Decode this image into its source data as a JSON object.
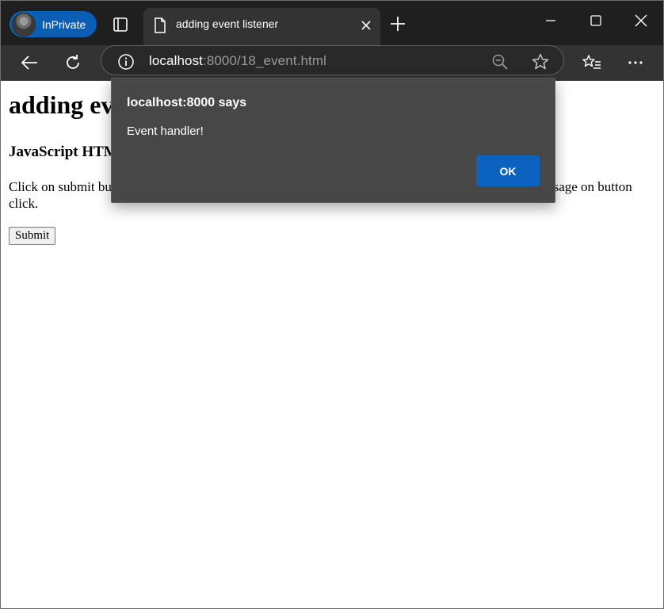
{
  "browser": {
    "inprivate_label": "InPrivate",
    "tab_title": "adding event listener",
    "address": {
      "host": "localhost",
      "path": ":8000/18_event.html"
    }
  },
  "page": {
    "heading": "adding event listener",
    "subheading": "JavaScript HTML DOM EventListener",
    "paragraph": "Click on submit button to see the addEventListener() method in action. This will display an alert message on button click.",
    "submit_label": "Submit"
  },
  "dialog": {
    "title": "localhost:8000 says",
    "message": "Event handler!",
    "ok_label": "OK"
  },
  "colors": {
    "tabstrip": "#1f1f1f",
    "toolbar": "#333333",
    "inprivate_badge": "#0a5fb4",
    "dialog_bg": "#474747",
    "ok_button": "#0c63bf"
  }
}
